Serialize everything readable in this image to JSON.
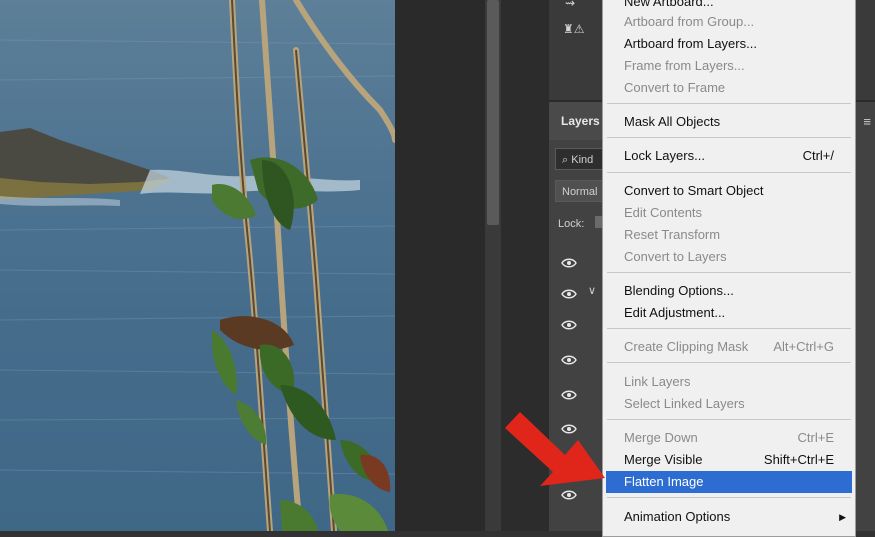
{
  "canvas": {
    "image_label": "photo-canvas"
  },
  "layers_panel": {
    "tab_label": "Layers",
    "kind_filter": "Kind",
    "blend_mode": "Normal",
    "lock_label": "Lock:"
  },
  "context_menu": {
    "items": [
      {
        "label": "New Artboard...",
        "shortcut": "",
        "disabled": false
      },
      {
        "label": "Artboard from Group...",
        "shortcut": "",
        "disabled": true
      },
      {
        "label": "Artboard from Layers...",
        "shortcut": "",
        "disabled": false
      },
      {
        "label": "Frame from Layers...",
        "shortcut": "",
        "disabled": true
      },
      {
        "label": "Convert to Frame",
        "shortcut": "",
        "disabled": true
      },
      {
        "label": "Mask All Objects",
        "shortcut": "",
        "disabled": false
      },
      {
        "label": "Lock Layers...",
        "shortcut": "Ctrl+/",
        "disabled": false
      },
      {
        "label": "Convert to Smart Object",
        "shortcut": "",
        "disabled": false
      },
      {
        "label": "Edit Contents",
        "shortcut": "",
        "disabled": true
      },
      {
        "label": "Reset Transform",
        "shortcut": "",
        "disabled": true
      },
      {
        "label": "Convert to Layers",
        "shortcut": "",
        "disabled": true
      },
      {
        "label": "Blending Options...",
        "shortcut": "",
        "disabled": false
      },
      {
        "label": "Edit Adjustment...",
        "shortcut": "",
        "disabled": false
      },
      {
        "label": "Create Clipping Mask",
        "shortcut": "Alt+Ctrl+G",
        "disabled": true
      },
      {
        "label": "Link Layers",
        "shortcut": "",
        "disabled": true
      },
      {
        "label": "Select Linked Layers",
        "shortcut": "",
        "disabled": true
      },
      {
        "label": "Merge Down",
        "shortcut": "Ctrl+E",
        "disabled": true
      },
      {
        "label": "Merge Visible",
        "shortcut": "Shift+Ctrl+E",
        "disabled": false
      },
      {
        "label": "Flatten Image",
        "shortcut": "",
        "disabled": false,
        "highlighted": true
      },
      {
        "label": "Animation Options",
        "shortcut": "",
        "disabled": false,
        "has_submenu": true
      }
    ]
  },
  "colors": {
    "menu_highlight": "#2d6dd2",
    "arrow": "#e0261b"
  }
}
